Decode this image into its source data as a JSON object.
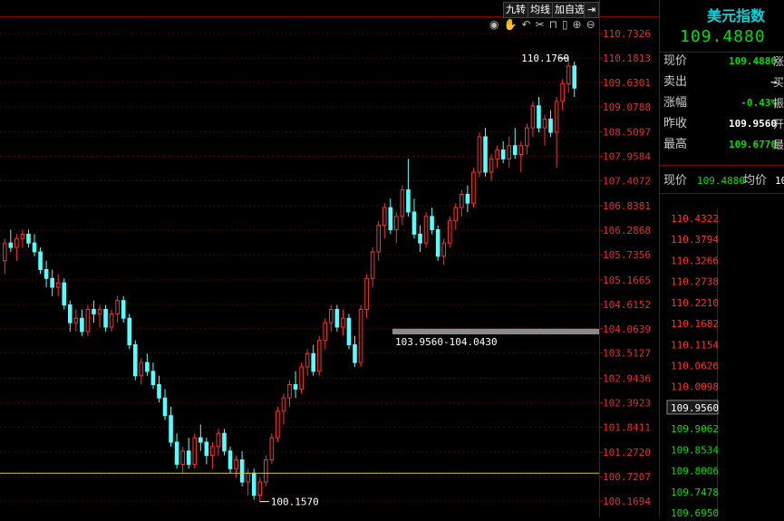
{
  "toolbar": {
    "nine_turn": "九转",
    "ma_line": "均线",
    "add_watch": "加自选"
  },
  "quote": {
    "name": "美元指数",
    "price": "109.4880",
    "rows": [
      {
        "label": "现价",
        "value": "109.4880",
        "color": "#00e000",
        "cut": "涨"
      },
      {
        "label": "卖出",
        "value": "—",
        "color": "#ccc",
        "cut": "买"
      },
      {
        "label": "涨幅",
        "value": "-0.43%",
        "color": "#00e000",
        "cut": "振"
      },
      {
        "label": "昨收",
        "value": "109.9560",
        "color": "#ffffff",
        "cut": "开"
      },
      {
        "label": "最高",
        "value": "109.6770",
        "color": "#00e000",
        "cut": "最"
      }
    ],
    "minute_bar": {
      "label1": "现价",
      "value1": "109.4880",
      "label2": "均价",
      "value2": "10"
    }
  },
  "minute_axis": {
    "ticks": [
      "110.4322",
      "110.3794",
      "110.3266",
      "110.2738",
      "110.2210",
      "110.1682",
      "110.1154",
      "110.0626",
      "110.0098",
      "109.9560",
      "109.9062",
      "109.8534",
      "109.8006",
      "109.7478",
      "109.6950"
    ],
    "ref_label": "109.9560"
  },
  "chart_data": {
    "type": "candlestick",
    "ylim": [
      100.1694,
      110.7326
    ],
    "y_ticks": [
      "110.7326",
      "110.1813",
      "109.6301",
      "109.0788",
      "108.5097",
      "107.9584",
      "107.4072",
      "106.8381",
      "106.2868",
      "105.7356",
      "105.1665",
      "104.6152",
      "104.0639",
      "103.5127",
      "102.9436",
      "102.3923",
      "101.8411",
      "101.2720",
      "100.7207",
      "100.1694"
    ],
    "annotations": {
      "high_label": "110.1760",
      "high_value": 110.176,
      "low_label": "100.1570",
      "low_value": 100.157,
      "band_label": "103.9560-104.0430",
      "band_low": 103.956,
      "band_high": 104.043,
      "hline_value": 100.8
    },
    "candles": [
      [
        105.6,
        106.1,
        105.3,
        106.0
      ],
      [
        106.0,
        106.3,
        105.8,
        105.9
      ],
      [
        105.9,
        106.2,
        105.6,
        106.1
      ],
      [
        106.1,
        106.3,
        105.9,
        106.2
      ],
      [
        106.2,
        106.3,
        105.9,
        106.0
      ],
      [
        106.0,
        106.2,
        105.7,
        105.8
      ],
      [
        105.8,
        105.9,
        105.3,
        105.4
      ],
      [
        105.4,
        105.6,
        105.0,
        105.2
      ],
      [
        105.2,
        105.4,
        104.8,
        105.0
      ],
      [
        105.0,
        105.3,
        104.8,
        105.1
      ],
      [
        105.1,
        105.2,
        104.5,
        104.6
      ],
      [
        104.6,
        104.7,
        104.0,
        104.2
      ],
      [
        104.2,
        104.5,
        104.0,
        104.3
      ],
      [
        104.3,
        104.5,
        103.9,
        104.0
      ],
      [
        104.0,
        104.6,
        103.9,
        104.5
      ],
      [
        104.5,
        104.7,
        104.2,
        104.4
      ],
      [
        104.4,
        104.6,
        104.1,
        104.5
      ],
      [
        104.5,
        104.6,
        104.0,
        104.1
      ],
      [
        104.1,
        104.5,
        104.0,
        104.4
      ],
      [
        104.4,
        104.8,
        104.2,
        104.7
      ],
      [
        104.7,
        104.8,
        104.2,
        104.3
      ],
      [
        104.3,
        104.4,
        103.6,
        103.7
      ],
      [
        103.7,
        103.8,
        102.9,
        103.0
      ],
      [
        103.0,
        103.4,
        102.8,
        103.3
      ],
      [
        103.3,
        103.5,
        103.0,
        103.1
      ],
      [
        103.1,
        103.3,
        102.7,
        102.8
      ],
      [
        102.8,
        103.0,
        102.4,
        102.5
      ],
      [
        102.5,
        102.7,
        102.0,
        102.1
      ],
      [
        102.1,
        102.3,
        101.4,
        101.5
      ],
      [
        101.5,
        101.7,
        100.9,
        101.0
      ],
      [
        101.0,
        101.4,
        100.8,
        101.3
      ],
      [
        101.3,
        101.6,
        100.9,
        101.0
      ],
      [
        101.0,
        101.7,
        100.9,
        101.6
      ],
      [
        101.6,
        101.9,
        101.3,
        101.5
      ],
      [
        101.5,
        101.6,
        101.0,
        101.2
      ],
      [
        101.2,
        101.5,
        100.9,
        101.4
      ],
      [
        101.4,
        101.8,
        101.2,
        101.7
      ],
      [
        101.7,
        101.8,
        101.2,
        101.3
      ],
      [
        101.3,
        101.4,
        100.8,
        100.9
      ],
      [
        100.9,
        101.2,
        100.7,
        101.1
      ],
      [
        101.1,
        101.3,
        100.5,
        100.6
      ],
      [
        100.6,
        100.9,
        100.3,
        100.8
      ],
      [
        100.8,
        100.9,
        100.2,
        100.3
      ],
      [
        100.3,
        100.7,
        100.16,
        100.6
      ],
      [
        100.6,
        101.2,
        100.5,
        101.1
      ],
      [
        101.1,
        101.7,
        101.0,
        101.6
      ],
      [
        101.6,
        102.3,
        101.5,
        102.2
      ],
      [
        102.2,
        102.6,
        101.9,
        102.5
      ],
      [
        102.5,
        102.9,
        102.3,
        102.8
      ],
      [
        102.8,
        103.1,
        102.5,
        102.7
      ],
      [
        102.7,
        103.3,
        102.6,
        103.2
      ],
      [
        103.2,
        103.6,
        103.0,
        103.5
      ],
      [
        103.5,
        103.7,
        103.0,
        103.1
      ],
      [
        103.1,
        103.9,
        103.0,
        103.8
      ],
      [
        103.8,
        104.3,
        103.6,
        104.2
      ],
      [
        104.2,
        104.6,
        104.0,
        104.5
      ],
      [
        104.5,
        104.6,
        104.0,
        104.1
      ],
      [
        104.1,
        104.5,
        103.9,
        104.3
      ],
      [
        104.3,
        104.4,
        103.6,
        103.7
      ],
      [
        103.7,
        103.9,
        103.2,
        103.3
      ],
      [
        103.3,
        104.6,
        103.2,
        104.5
      ],
      [
        104.5,
        105.3,
        104.3,
        105.2
      ],
      [
        105.2,
        105.9,
        105.0,
        105.8
      ],
      [
        105.8,
        106.5,
        105.6,
        106.4
      ],
      [
        106.4,
        106.9,
        106.1,
        106.8
      ],
      [
        106.8,
        107.0,
        106.2,
        106.3
      ],
      [
        106.3,
        106.7,
        106.0,
        106.6
      ],
      [
        106.6,
        107.3,
        106.4,
        107.2
      ],
      [
        107.2,
        107.9,
        106.6,
        106.7
      ],
      [
        106.7,
        107.0,
        106.1,
        106.2
      ],
      [
        106.2,
        106.4,
        105.8,
        106.0
      ],
      [
        106.0,
        106.7,
        105.9,
        106.6
      ],
      [
        106.6,
        106.8,
        106.2,
        106.3
      ],
      [
        106.3,
        106.4,
        105.6,
        105.7
      ],
      [
        105.7,
        106.1,
        105.5,
        106.0
      ],
      [
        106.0,
        106.6,
        105.9,
        106.5
      ],
      [
        106.5,
        106.9,
        106.3,
        106.8
      ],
      [
        106.8,
        107.2,
        106.6,
        107.1
      ],
      [
        107.1,
        107.3,
        106.7,
        106.9
      ],
      [
        106.9,
        107.7,
        106.8,
        107.6
      ],
      [
        107.6,
        108.5,
        107.5,
        108.4
      ],
      [
        108.4,
        108.6,
        107.5,
        107.6
      ],
      [
        107.6,
        108.0,
        107.4,
        107.9
      ],
      [
        107.9,
        108.2,
        107.7,
        108.1
      ],
      [
        108.1,
        108.3,
        107.8,
        107.9
      ],
      [
        107.9,
        108.4,
        107.7,
        108.2
      ],
      [
        108.2,
        108.6,
        107.9,
        108.0
      ],
      [
        108.0,
        108.3,
        107.6,
        108.2
      ],
      [
        108.2,
        108.7,
        108.0,
        108.6
      ],
      [
        108.6,
        109.2,
        108.4,
        109.1
      ],
      [
        109.1,
        109.3,
        108.5,
        108.6
      ],
      [
        108.6,
        108.9,
        108.2,
        108.8
      ],
      [
        108.8,
        109.0,
        108.4,
        108.5
      ],
      [
        108.5,
        109.3,
        107.7,
        109.2
      ],
      [
        109.2,
        109.7,
        109.0,
        109.6
      ],
      [
        109.6,
        110.18,
        109.4,
        110.0
      ],
      [
        110.0,
        110.1,
        109.3,
        109.5
      ]
    ]
  }
}
